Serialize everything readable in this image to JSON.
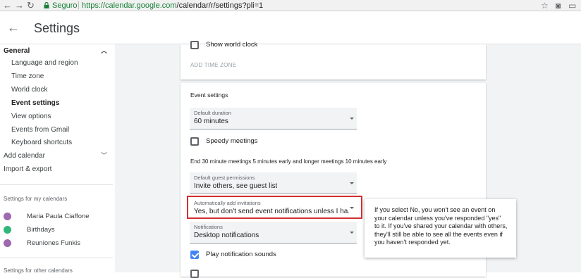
{
  "browser": {
    "secure_label": "Seguro",
    "url_host": "https://calendar.google.com",
    "url_path": "/calendar/r/settings?pli=1"
  },
  "header": {
    "title": "Settings"
  },
  "sidebar": {
    "general": "General",
    "sub_items": [
      "Language and region",
      "Time zone",
      "World clock",
      "Event settings",
      "View options",
      "Events from Gmail",
      "Keyboard shortcuts"
    ],
    "add_calendar": "Add calendar",
    "import_export": "Import & export",
    "my_calendars_heading": "Settings for my calendars",
    "calendars": [
      {
        "name": "Maria Paula Ciaffone",
        "color": "#9e69af"
      },
      {
        "name": "Birthdays",
        "color": "#33b679"
      },
      {
        "name": "Reuniones Funkis",
        "color": "#9e69af"
      }
    ],
    "other_calendars_heading": "Settings for other calendars"
  },
  "world_clock_card": {
    "show_world_clock": "Show world clock",
    "add_time_zone": "ADD TIME ZONE"
  },
  "event_settings": {
    "heading": "Event settings",
    "default_duration": {
      "label": "Default duration",
      "value": "60 minutes"
    },
    "speedy_meetings": "Speedy meetings",
    "speedy_note": "End 30 minute meetings 5 minutes early and longer meetings 10 minutes early",
    "guest_permissions": {
      "label": "Default guest permissions",
      "value": "Invite others, see guest list"
    },
    "auto_add": {
      "label": "Automatically add invitations",
      "value": "Yes, but don't send event notifications unless I ha..."
    },
    "notifications": {
      "label": "Notifications",
      "value": "Desktop notifications"
    },
    "play_sounds": "Play notification sounds",
    "play_sounds_checked": true
  },
  "tooltip": {
    "text": "If you select No, you won't see an event on your calendar unless you've responded \"yes\" to it. If you've shared your calendar with others, they'll still be able to see all the events even if you haven't responded yet."
  },
  "colors": {
    "accent": "#4285f4",
    "highlight": "#d32f2f"
  }
}
